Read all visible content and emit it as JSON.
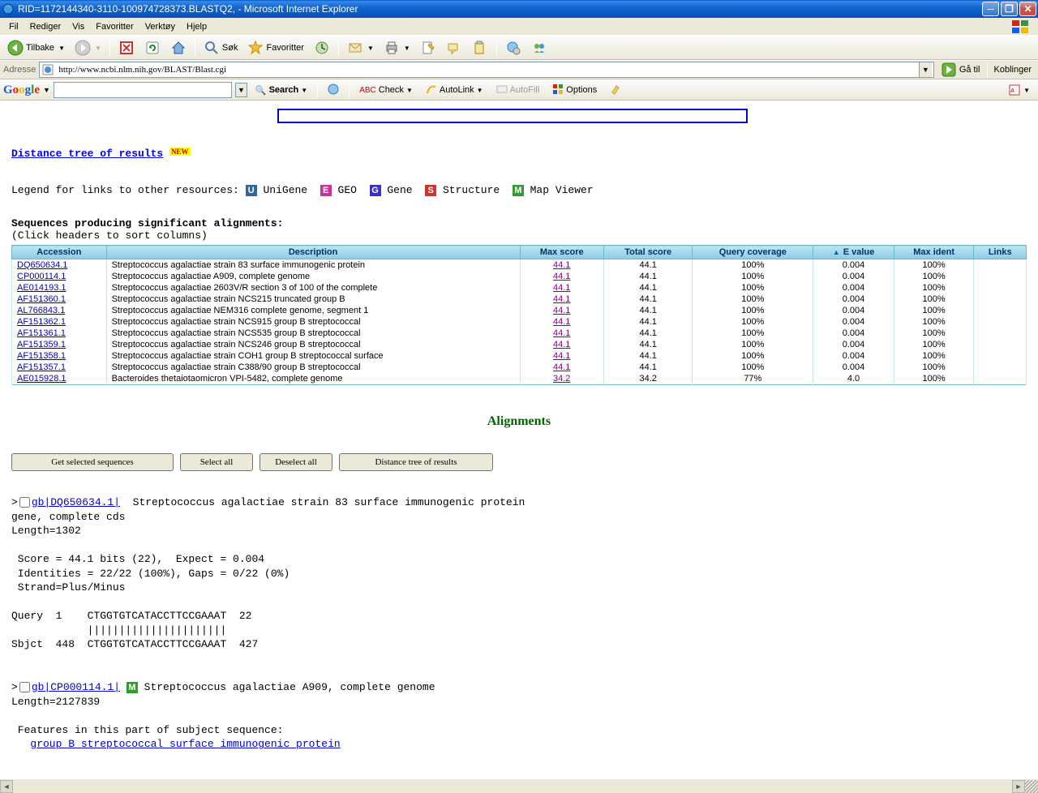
{
  "window": {
    "title": "RID=1172144340-3110-100974728373.BLASTQ2, - Microsoft Internet Explorer"
  },
  "menus": [
    "Fil",
    "Rediger",
    "Vis",
    "Favoritter",
    "Verktøy",
    "Hjelp"
  ],
  "toolbar": {
    "back": "Tilbake",
    "search": "Søk",
    "favorites": "Favoritter"
  },
  "address": {
    "label": "Adresse",
    "url": "http://www.ncbi.nlm.nih.gov/BLAST/Blast.cgi",
    "go": "Gå til",
    "links": "Koblinger"
  },
  "google_toolbar": {
    "search_btn": "Search",
    "check": "Check",
    "autolink": "AutoLink",
    "autofill": "AutoFill",
    "options": "Options"
  },
  "page": {
    "distance_tree": "Distance tree of results",
    "new_badge": "NEW",
    "legend_label": "Legend for links to other resources:",
    "legend": {
      "unigene": "UniGene",
      "geo": "GEO",
      "gene": "Gene",
      "structure": "Structure",
      "mapviewer": "Map Viewer"
    },
    "seq_heading": "Sequences producing significant alignments:",
    "seq_sub": "(Click headers to sort columns)",
    "headers": {
      "accession": "Accession",
      "description": "Description",
      "maxscore": "Max score",
      "totalscore": "Total score",
      "query": "Query coverage",
      "evalue": "E value",
      "maxident": "Max ident",
      "links": "Links"
    },
    "rows": [
      {
        "acc": "DQ650634.1",
        "desc": "Streptococcus agalactiae strain 83 surface immunogenic protein",
        "max": "44.1",
        "total": "44.1",
        "q": "100%",
        "e": "0.004",
        "ident": "100%"
      },
      {
        "acc": "CP000114.1",
        "desc": "Streptococcus agalactiae A909, complete genome",
        "max": "44.1",
        "total": "44.1",
        "q": "100%",
        "e": "0.004",
        "ident": "100%"
      },
      {
        "acc": "AE014193.1",
        "desc": "Streptococcus agalactiae 2603V/R section 3 of 100 of the complete",
        "max": "44.1",
        "total": "44.1",
        "q": "100%",
        "e": "0.004",
        "ident": "100%"
      },
      {
        "acc": "AF151360.1",
        "desc": "Streptococcus agalactiae strain NCS215 truncated group B",
        "max": "44.1",
        "total": "44.1",
        "q": "100%",
        "e": "0.004",
        "ident": "100%"
      },
      {
        "acc": "AL766843.1",
        "desc": "Streptococcus agalactiae NEM316 complete genome, segment 1",
        "max": "44.1",
        "total": "44.1",
        "q": "100%",
        "e": "0.004",
        "ident": "100%"
      },
      {
        "acc": "AF151362.1",
        "desc": "Streptococcus agalactiae strain NCS915 group B streptococcal",
        "max": "44.1",
        "total": "44.1",
        "q": "100%",
        "e": "0.004",
        "ident": "100%"
      },
      {
        "acc": "AF151361.1",
        "desc": "Streptococcus agalactiae strain NCS535 group B streptococcal",
        "max": "44.1",
        "total": "44.1",
        "q": "100%",
        "e": "0.004",
        "ident": "100%"
      },
      {
        "acc": "AF151359.1",
        "desc": "Streptococcus agalactiae strain NCS246 group B streptococcal",
        "max": "44.1",
        "total": "44.1",
        "q": "100%",
        "e": "0.004",
        "ident": "100%"
      },
      {
        "acc": "AF151358.1",
        "desc": "Streptococcus agalactiae strain COH1 group B streptococcal surface",
        "max": "44.1",
        "total": "44.1",
        "q": "100%",
        "e": "0.004",
        "ident": "100%"
      },
      {
        "acc": "AF151357.1",
        "desc": "Streptococcus agalactiae strain C388/90 group B streptococcal",
        "max": "44.1",
        "total": "44.1",
        "q": "100%",
        "e": "0.004",
        "ident": "100%"
      },
      {
        "acc": "AE015928.1",
        "desc": "Bacteroides thetaiotaomicron VPI-5482, complete genome",
        "max": "34.2",
        "total": "34.2",
        "q": "77%",
        "e": "4.0",
        "ident": "100%"
      }
    ],
    "alignments_title": "Alignments",
    "buttons": {
      "get_selected": "Get selected sequences",
      "select_all": "Select all",
      "deselect_all": "Deselect all",
      "distance_tree": "Distance tree of results"
    },
    "alignment1": {
      "link": "gb|DQ650634.1|",
      "title": "Streptococcus agalactiae strain 83 surface immunogenic protein",
      "line2": "gene, complete cds",
      "length": "Length=1302",
      "score": " Score = 44.1 bits (22),  Expect = 0.004",
      "ident": " Identities = 22/22 (100%), Gaps = 0/22 (0%)",
      "strand": " Strand=Plus/Minus",
      "query": "Query  1    CTGGTGTCATACCTTCCGAAAT  22",
      "bars": "            ||||||||||||||||||||||",
      "sbjct": "Sbjct  448  CTGGTGTCATACCTTCCGAAAT  427"
    },
    "alignment2": {
      "link": "gb|CP000114.1|",
      "title": "Streptococcus agalactiae A909, complete genome",
      "length": "Length=2127839",
      "features": " Features in this part of subject sequence:",
      "feature_link": "group B streptococcal surface immunogenic protein"
    }
  }
}
